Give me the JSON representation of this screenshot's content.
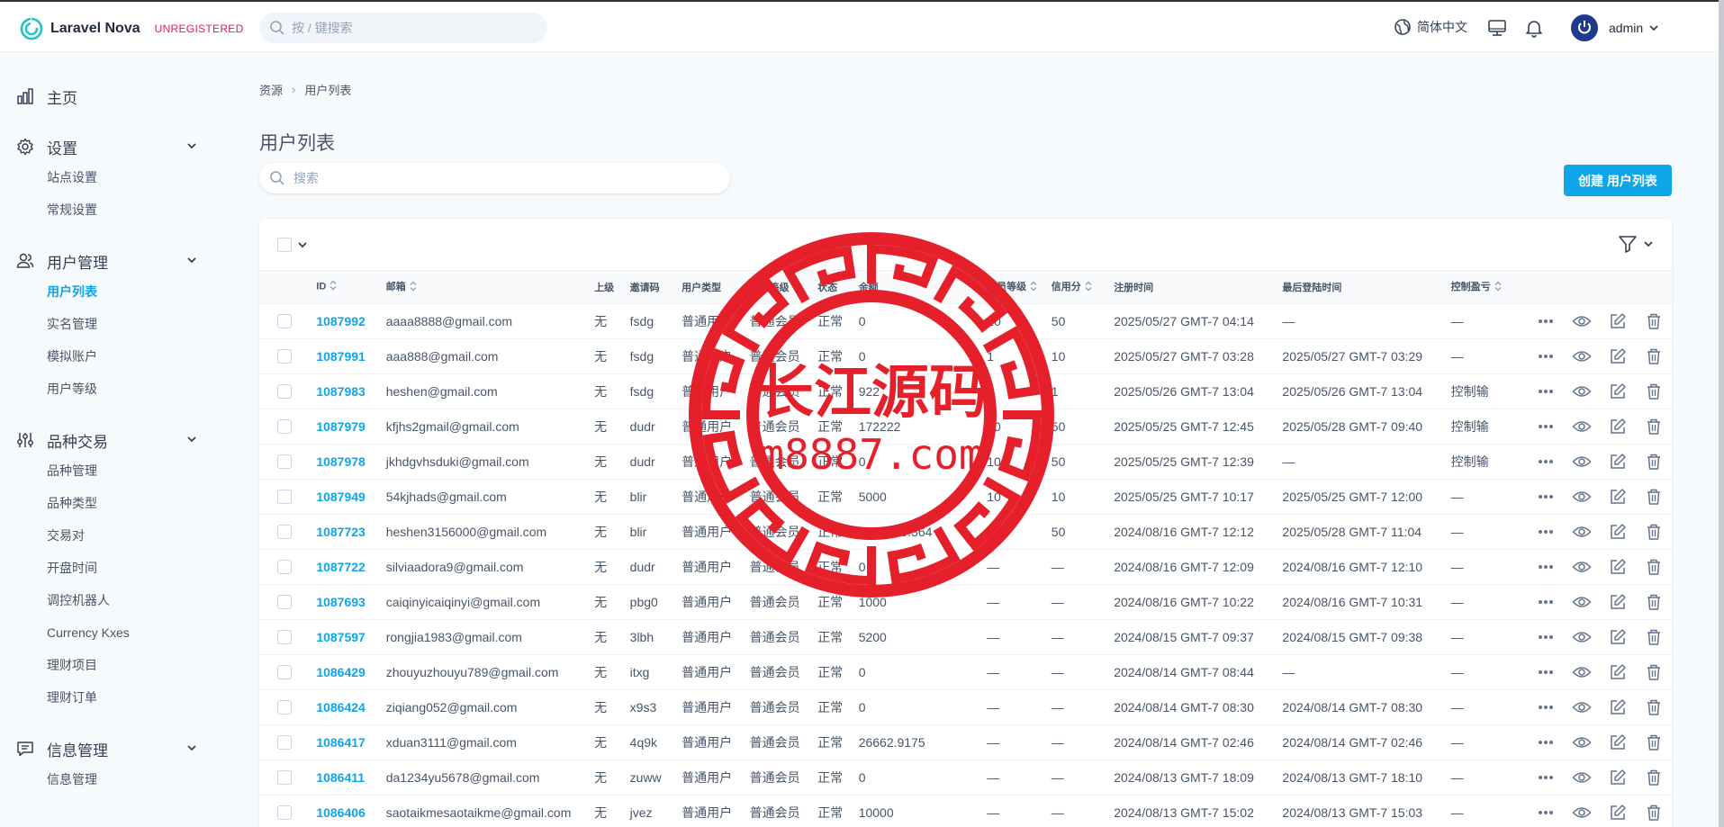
{
  "app": {
    "name": "Laravel Nova",
    "license_badge": "UNREGISTERED",
    "search_placeholder": "按 / 键搜索",
    "language": "简体中文",
    "user": "admin"
  },
  "sidebar": {
    "groups": [
      {
        "title": "主页",
        "icon": "chart-bar-icon",
        "items": []
      },
      {
        "title": "设置",
        "icon": "gear-icon",
        "items": [
          "站点设置",
          "常规设置"
        ]
      },
      {
        "title": "用户管理",
        "icon": "users-icon",
        "items": [
          "用户列表",
          "实名管理",
          "模拟账户",
          "用户等级"
        ]
      },
      {
        "title": "品种交易",
        "icon": "sliders-icon",
        "items": [
          "品种管理",
          "品种类型",
          "交易对",
          "开盘时间",
          "调控机器人",
          "Currency Kxes",
          "理财项目",
          "理财订单"
        ]
      },
      {
        "title": "信息管理",
        "icon": "chat-icon",
        "items": [
          "信息管理"
        ]
      }
    ],
    "active_item": "用户列表"
  },
  "breadcrumb": [
    "资源",
    "用户列表"
  ],
  "page": {
    "title": "用户列表",
    "search_placeholder": "搜索",
    "create_button": "创建 用户列表"
  },
  "table": {
    "columns": [
      "ID",
      "邮箱",
      "上级",
      "邀请码",
      "用户类型",
      "用户等级",
      "状态",
      "余额",
      "会员等级",
      "信用分",
      "注册时间",
      "最后登陆时间",
      "控制盈亏"
    ],
    "sortable": [
      "ID",
      "邮箱",
      "会员等级",
      "信用分",
      "控制盈亏"
    ],
    "rows": [
      {
        "id": "1087992",
        "email": "aaaa8888@gmail.com",
        "parent": "无",
        "invite": "fsdg",
        "utype": "普通用户",
        "ulevel": "普通会员",
        "status": "正常",
        "balance": "0",
        "vip": "10",
        "credit": "50",
        "reg": "2025/05/27 GMT-7 04:14",
        "last": "—",
        "ctrl": "—"
      },
      {
        "id": "1087991",
        "email": "aaa888@gmail.com",
        "parent": "无",
        "invite": "fsdg",
        "utype": "普通用户",
        "ulevel": "普通会员",
        "status": "正常",
        "balance": "0",
        "vip": "1",
        "credit": "10",
        "reg": "2025/05/27 GMT-7 03:28",
        "last": "2025/05/27 GMT-7 03:29",
        "ctrl": "—"
      },
      {
        "id": "1087983",
        "email": "heshen@gmail.com",
        "parent": "无",
        "invite": "fsdg",
        "utype": "普通用户",
        "ulevel": "普通会员",
        "status": "正常",
        "balance": "922",
        "vip": "1",
        "credit": "1",
        "reg": "2025/05/26 GMT-7 13:04",
        "last": "2025/05/26 GMT-7 13:04",
        "ctrl": "控制输"
      },
      {
        "id": "1087979",
        "email": "kfjhs2gmail@gmail.com",
        "parent": "无",
        "invite": "dudr",
        "utype": "普通用户",
        "ulevel": "普通会员",
        "status": "正常",
        "balance": "172222",
        "vip": "10",
        "credit": "50",
        "reg": "2025/05/25 GMT-7 12:45",
        "last": "2025/05/28 GMT-7 09:40",
        "ctrl": "控制输"
      },
      {
        "id": "1087978",
        "email": "jkhdgvhsduki@gmail.com",
        "parent": "无",
        "invite": "dudr",
        "utype": "普通用户",
        "ulevel": "普通会员",
        "status": "正常",
        "balance": "0",
        "vip": "10",
        "credit": "50",
        "reg": "2025/05/25 GMT-7 12:39",
        "last": "—",
        "ctrl": "控制输"
      },
      {
        "id": "1087949",
        "email": "54kjhads@gmail.com",
        "parent": "无",
        "invite": "blir",
        "utype": "普通用户",
        "ulevel": "普通会员",
        "status": "正常",
        "balance": "5000",
        "vip": "10",
        "credit": "10",
        "reg": "2025/05/25 GMT-7 10:17",
        "last": "2025/05/25 GMT-7 12:00",
        "ctrl": "—"
      },
      {
        "id": "1087723",
        "email": "heshen3156000@gmail.com",
        "parent": "无",
        "invite": "blir",
        "utype": "普通用户",
        "ulevel": "普通会员",
        "status": "正常",
        "balance": "4467929.364",
        "vip": "高",
        "credit": "50",
        "reg": "2024/08/16 GMT-7 12:12",
        "last": "2025/05/28 GMT-7 11:04",
        "ctrl": "—"
      },
      {
        "id": "1087722",
        "email": "silviaadora9@gmail.com",
        "parent": "无",
        "invite": "dudr",
        "utype": "普通用户",
        "ulevel": "普通会员",
        "status": "正常",
        "balance": "0",
        "vip": "—",
        "credit": "—",
        "reg": "2024/08/16 GMT-7 12:09",
        "last": "2024/08/16 GMT-7 12:10",
        "ctrl": "—"
      },
      {
        "id": "1087693",
        "email": "caiqinyicaiqinyi@gmail.com",
        "parent": "无",
        "invite": "pbg0",
        "utype": "普通用户",
        "ulevel": "普通会员",
        "status": "正常",
        "balance": "1000",
        "vip": "—",
        "credit": "—",
        "reg": "2024/08/16 GMT-7 10:22",
        "last": "2024/08/16 GMT-7 10:31",
        "ctrl": "—"
      },
      {
        "id": "1087597",
        "email": "rongjia1983@gmail.com",
        "parent": "无",
        "invite": "3lbh",
        "utype": "普通用户",
        "ulevel": "普通会员",
        "status": "正常",
        "balance": "5200",
        "vip": "—",
        "credit": "—",
        "reg": "2024/08/15 GMT-7 09:37",
        "last": "2024/08/15 GMT-7 09:38",
        "ctrl": "—"
      },
      {
        "id": "1086429",
        "email": "zhouyuzhouyu789@gmail.com",
        "parent": "无",
        "invite": "itxg",
        "utype": "普通用户",
        "ulevel": "普通会员",
        "status": "正常",
        "balance": "0",
        "vip": "—",
        "credit": "—",
        "reg": "2024/08/14 GMT-7 08:44",
        "last": "—",
        "ctrl": "—"
      },
      {
        "id": "1086424",
        "email": "ziqiang052@gmail.com",
        "parent": "无",
        "invite": "x9s3",
        "utype": "普通用户",
        "ulevel": "普通会员",
        "status": "正常",
        "balance": "0",
        "vip": "—",
        "credit": "—",
        "reg": "2024/08/14 GMT-7 08:30",
        "last": "2024/08/14 GMT-7 08:30",
        "ctrl": "—"
      },
      {
        "id": "1086417",
        "email": "xduan3111@gmail.com",
        "parent": "无",
        "invite": "4q9k",
        "utype": "普通用户",
        "ulevel": "普通会员",
        "status": "正常",
        "balance": "26662.9175",
        "vip": "—",
        "credit": "—",
        "reg": "2024/08/14 GMT-7 02:46",
        "last": "2024/08/14 GMT-7 02:46",
        "ctrl": "—"
      },
      {
        "id": "1086411",
        "email": "da1234yu5678@gmail.com",
        "parent": "无",
        "invite": "zuww",
        "utype": "普通用户",
        "ulevel": "普通会员",
        "status": "正常",
        "balance": "0",
        "vip": "—",
        "credit": "—",
        "reg": "2024/08/13 GMT-7 18:09",
        "last": "2024/08/13 GMT-7 18:10",
        "ctrl": "—"
      },
      {
        "id": "1086406",
        "email": "saotaikmesaotaikme@gmail.com",
        "parent": "无",
        "invite": "jvez",
        "utype": "普通用户",
        "ulevel": "普通会员",
        "status": "正常",
        "balance": "10000",
        "vip": "—",
        "credit": "—",
        "reg": "2024/08/13 GMT-7 15:02",
        "last": "2024/08/13 GMT-7 15:03",
        "ctrl": "—"
      }
    ]
  },
  "watermark": {
    "title": "长江源码",
    "url": "m8887.com",
    "color": "#e5202a"
  },
  "colors": {
    "accent": "#0ea5e9",
    "danger": "#e11d48"
  }
}
